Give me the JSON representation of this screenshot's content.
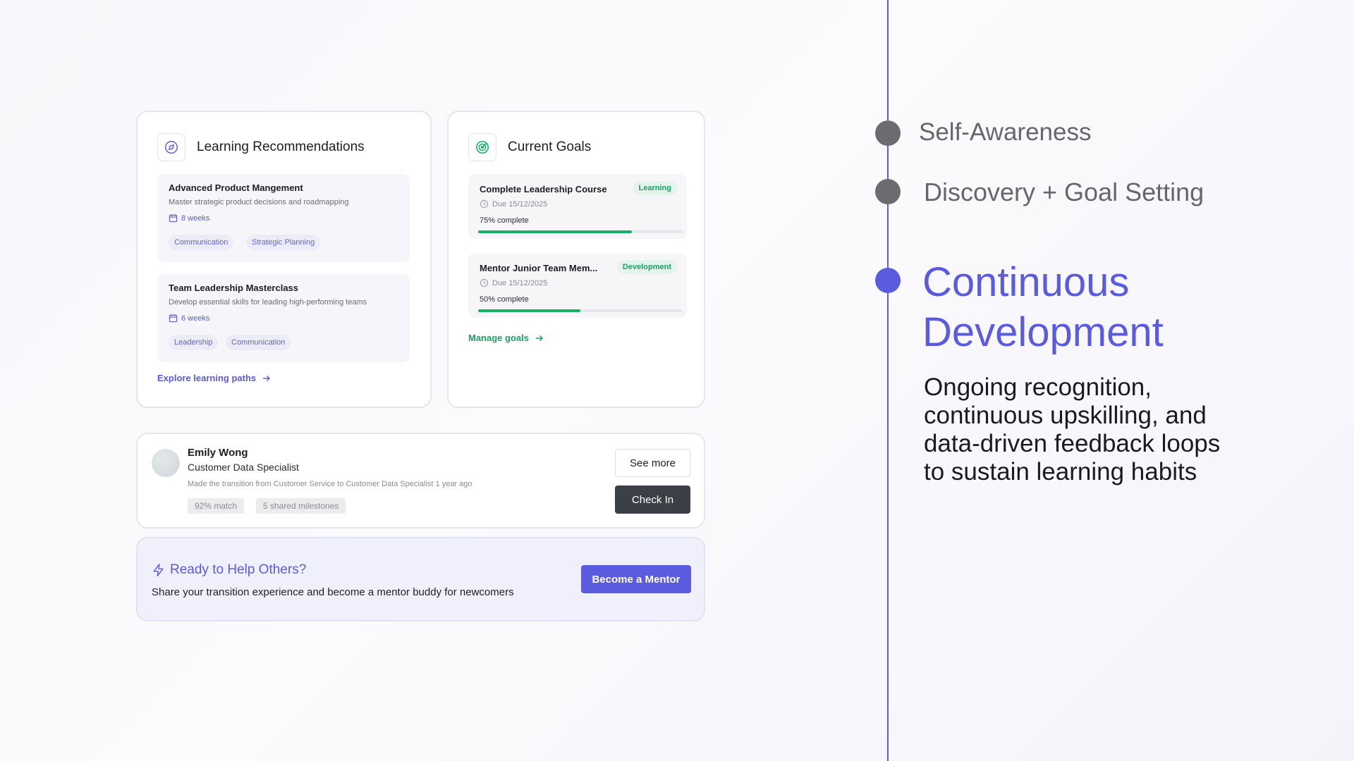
{
  "learning": {
    "title": "Learning Recommendations",
    "items": [
      {
        "title": "Advanced Product Mangement",
        "desc": "Master strategic product decisions and roadmapping",
        "duration": "8 weeks",
        "tags": [
          "Communication",
          "Strategic Planning"
        ]
      },
      {
        "title": "Team Leadership Masterclass",
        "desc": "Develop essential skills for leading high-performing teams",
        "duration": "6 weeks",
        "tags": [
          "Leadership",
          "Communication"
        ]
      }
    ],
    "link": "Explore learning paths"
  },
  "goals": {
    "title": "Current Goals",
    "items": [
      {
        "title": "Complete Leadership Course",
        "badge": "Learning",
        "due": "Due 15/12/2025",
        "progress_label": "75% complete",
        "progress": 0.75
      },
      {
        "title": "Mentor Junior Team Mem...",
        "badge": "Development",
        "due": "Due 15/12/2025",
        "progress_label": "50% complete",
        "progress": 0.5
      }
    ],
    "link": "Manage goals"
  },
  "buddy": {
    "name": "Emily Wong",
    "role": "Customer Data Specialist",
    "note": "Made the transition from Customer Service to Customer Data Specialist 1 year ago",
    "chips": [
      "92% match",
      "5 shared milestones"
    ],
    "see_more": "See more",
    "check_in": "Check In"
  },
  "mentor": {
    "title": "Ready to Help Others?",
    "desc": "Share your transition experience and become a mentor buddy for newcomers",
    "button": "Become a Mentor"
  },
  "timeline": {
    "steps": [
      "Self-Awareness",
      "Discovery + Goal Setting"
    ],
    "active_title_line1": "Continuous",
    "active_title_line2": "Development",
    "active_desc_lines": [
      "Ongoing recognition,",
      "continuous upskilling, and",
      "data-driven feedback loops",
      "to sustain learning habits"
    ]
  },
  "colors": {
    "accent": "#5b5be0",
    "green": "#16b26c",
    "dark_button": "#3b4048",
    "inactive_dot": "#6b6b70"
  }
}
